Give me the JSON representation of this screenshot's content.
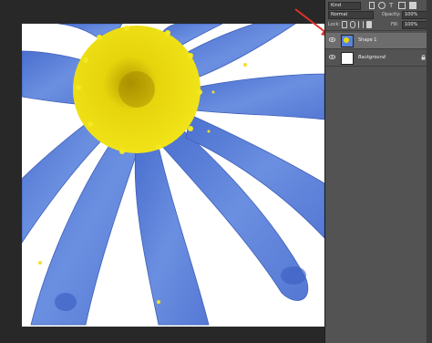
{
  "panel": {
    "top_value": "Kind",
    "blend_mode": "Normal",
    "opacity_label": "Opacity:",
    "opacity_value": "100%",
    "lock_label": "Lock:",
    "fill_label": "Fill:",
    "fill_value": "100%"
  },
  "layers": [
    {
      "name": "Shape 1",
      "selected": true
    },
    {
      "name": "Background",
      "selected": false
    }
  ],
  "colors": {
    "petal": "#5b82d6",
    "petal_dark": "#3c5fbe",
    "center": "#e8d80a",
    "panel_bg": "#535353",
    "selected_row": "#6d6d6d",
    "arrow": "#e0322b"
  },
  "icons": [
    "eye-icon",
    "padlock-icon",
    "arrow-icon",
    "lock-transparent-icon",
    "lock-brush-icon",
    "lock-move-icon",
    "lock-all-icon"
  ]
}
